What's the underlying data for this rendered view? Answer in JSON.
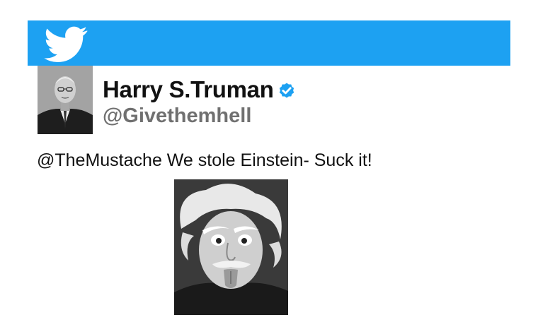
{
  "colors": {
    "banner": "#1da1f2",
    "verified_badge": "#1da1f2",
    "handle_gray": "#707070"
  },
  "header": {
    "logo_icon": "twitter-bird-icon"
  },
  "profile": {
    "display_name": "Harry S.Truman",
    "handle": "@Givethemhell",
    "verified_icon": "verified-badge-icon"
  },
  "tweet": {
    "text": "@TheMustache We stole Einstein- Suck it!"
  }
}
